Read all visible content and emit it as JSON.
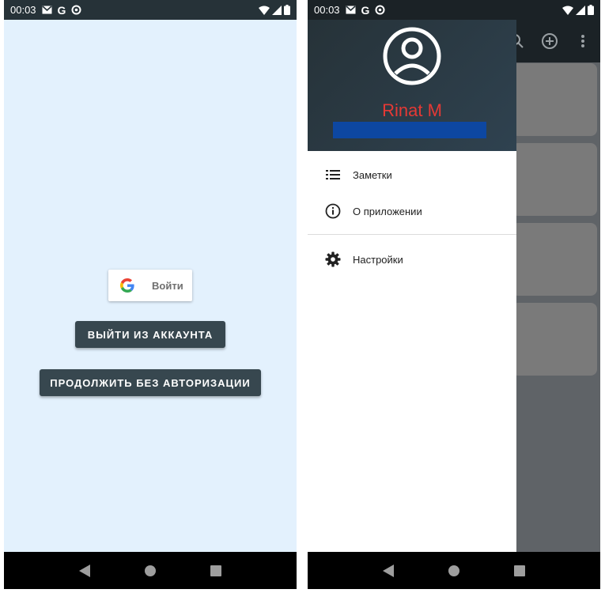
{
  "status_bar": {
    "time": "00:03",
    "notification_icons": [
      "gmail-icon",
      "google-icon",
      "sync-icon"
    ],
    "system_icons": [
      "wifi-icon",
      "cell-signal-icon",
      "battery-icon"
    ]
  },
  "login_screen": {
    "google_button_label": "Войти",
    "logout_button_label": "ВЫЙТИ ИЗ АККАУНТА",
    "continue_button_label": "ПРОДОЛЖИТЬ БЕЗ АВТОРИЗАЦИИ"
  },
  "drawer": {
    "user_name": "Rinat M",
    "items": [
      {
        "label": "Заметки",
        "icon": "list-icon"
      },
      {
        "label": "О приложении",
        "icon": "info-icon"
      },
      {
        "label": "Настройки",
        "icon": "gear-icon"
      }
    ]
  },
  "toolbar": {
    "icons": [
      "search-icon",
      "add-circle-icon",
      "more-vert-icon"
    ]
  },
  "colors": {
    "status_bar": "#263238",
    "login_background": "#e3f1fd",
    "dark_button": "#37474f",
    "user_name": "#e53935",
    "email_bar": "#0d47a1",
    "header_background": "#263238"
  }
}
